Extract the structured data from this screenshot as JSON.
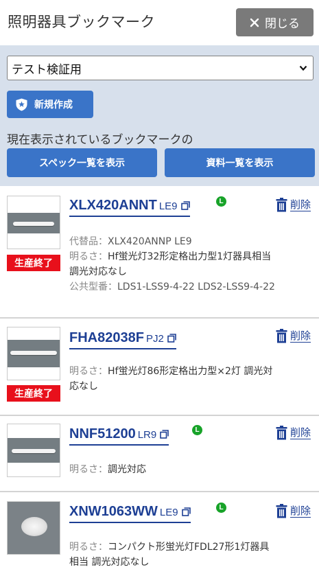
{
  "header": {
    "title": "照明器具ブックマーク",
    "close_label": "閉じる"
  },
  "panel": {
    "selected_folder": "テスト検証用",
    "new_button_label": "新規作成",
    "info_text": "現在表示されているブックマークの",
    "spec_button_label": "スペック一覧を表示",
    "docs_button_label": "資料一覧を表示"
  },
  "labels": {
    "delete": "削除",
    "eol": "生産終了",
    "leaf_mark": "L"
  },
  "items": [
    {
      "name": "XLX420ANNT",
      "suffix": "LE9",
      "line1_label": "代替品：",
      "line1_value": "XLX420ANNP LE9",
      "line2_label": "明るさ：",
      "line2_value": "Hf蛍光灯32形定格出力型1灯器具相当",
      "line3": "調光対応なし",
      "line4_label": "公共型番：",
      "line4_value": "LDS1-LSS9-4-22 LDS2-LSS9-4-22"
    },
    {
      "name": "FHA82038F",
      "suffix": "PJ2",
      "line1_label": "明るさ：",
      "line1_value": "Hf蛍光灯86形定格出力型×2灯 調光対",
      "line2": "応なし"
    },
    {
      "name": "NNF51200",
      "suffix": "LR9",
      "line1_label": "明るさ：",
      "line1_value": "調光対応"
    },
    {
      "name": "XNW1063WW",
      "suffix": "LE9",
      "line1_label": "明るさ：",
      "line1_value": "コンパクト形蛍光灯FDL27形1灯器具",
      "line2": "相当 調光対応なし"
    }
  ],
  "colors": {
    "accent": "#3a74c8",
    "link": "#1d3f94",
    "eol": "#e8101b",
    "leaf": "#18a329",
    "panel_bg": "#d7e0ec",
    "close_bg": "#7a7a7a"
  },
  "icons": [
    "close-icon",
    "chevron-down-icon",
    "shield-star-icon",
    "copy-icon",
    "leaf-icon",
    "trash-icon"
  ]
}
